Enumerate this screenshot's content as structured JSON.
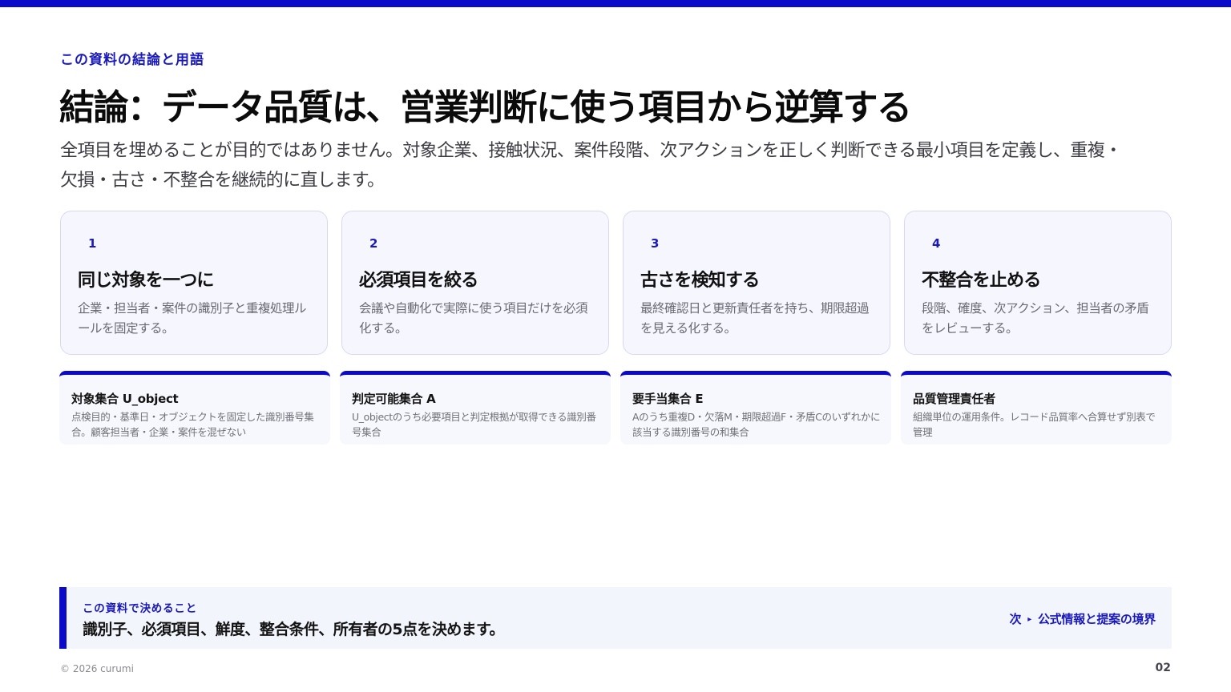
{
  "colors": {
    "accent": "#0a0ac8",
    "card_bg": "#f6f7fe",
    "card_border": "#d7d9f4"
  },
  "header": {
    "eyebrow": "この資料の結論と用語",
    "title": "結論：データ品質は、営業判断に使う項目から逆算する",
    "lead": "全項目を埋めることが目的ではありません。対象企業、接触状況、案件段階、次アクションを正しく判断できる最小項目を定義し、重複・欠損・古さ・不整合を継続的に直します。"
  },
  "cards": [
    {
      "num": "1",
      "title": "同じ対象を一つに",
      "desc": "企業・担当者・案件の識別子と重複処理ルールを固定する。"
    },
    {
      "num": "2",
      "title": "必須項目を絞る",
      "desc": "会議や自動化で実際に使う項目だけを必須化する。"
    },
    {
      "num": "3",
      "title": "古さを検知する",
      "desc": "最終確認日と更新責任者を持ち、期限超過を見える化する。"
    },
    {
      "num": "4",
      "title": "不整合を止める",
      "desc": "段階、確度、次アクション、担当者の矛盾をレビューする。"
    }
  ],
  "definitions": [
    {
      "title": "対象集合 U_object",
      "desc": "点検目的・基準日・オブジェクトを固定した識別番号集合。顧客担当者・企業・案件を混ぜない"
    },
    {
      "title": "判定可能集合 A",
      "desc": "U_objectのうち必要項目と判定根拠が取得できる識別番号集合"
    },
    {
      "title": "要手当集合 E",
      "desc": "Aのうち重複D・欠落M・期限超過F・矛盾Cのいずれかに該当する識別番号の和集合"
    },
    {
      "title": "品質管理責任者",
      "desc": "組織単位の運用条件。レコード品質率へ合算せず別表で管理"
    }
  ],
  "decision": {
    "label": "この資料で決めること",
    "text": "識別子、必須項目、鮮度、整合条件、所有者の5点を決めます。",
    "next_prefix": "次",
    "next_arrow": "▸",
    "next_label": "公式情報と提案の境界"
  },
  "footer": {
    "copyright": "© 2026 curumi",
    "page": "02"
  }
}
